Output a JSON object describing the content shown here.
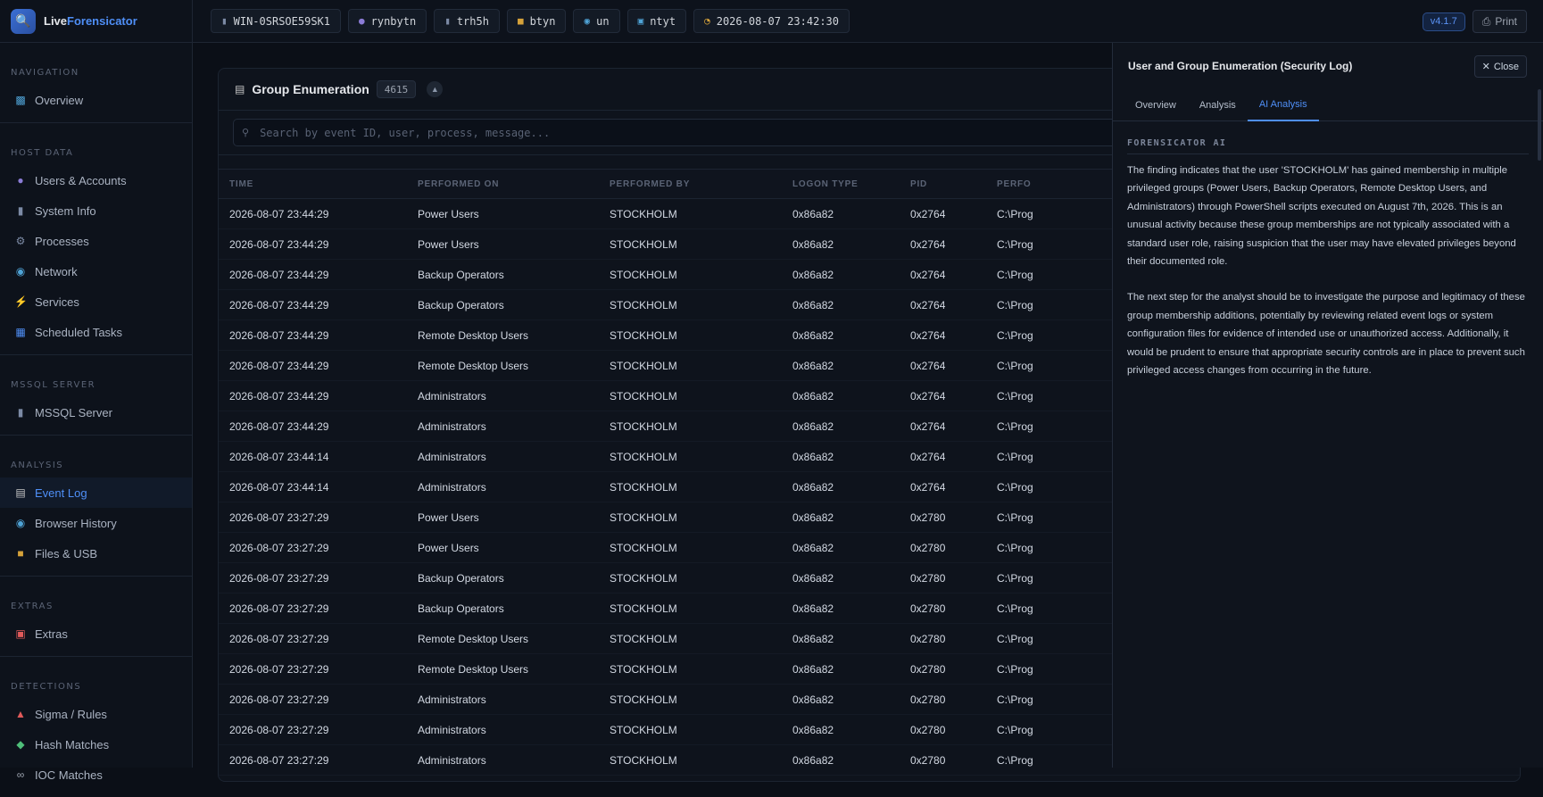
{
  "app": {
    "brand_prefix": "Live",
    "brand_suffix": "Forensicator",
    "version": "v4.1.7",
    "print_label": "Print"
  },
  "topbar": {
    "chips": [
      {
        "icon": "server-icon",
        "text": "WIN-0SRSOE59SK1"
      },
      {
        "icon": "user-icon",
        "text": "rynbytn"
      },
      {
        "icon": "server-icon",
        "text": "trh5h"
      },
      {
        "icon": "folder-icon",
        "text": "btyn"
      },
      {
        "icon": "globe-icon",
        "text": "un"
      },
      {
        "icon": "monitor-icon",
        "text": "ntyt"
      },
      {
        "icon": "clock-icon",
        "text": "2026-08-07 23:42:30"
      }
    ]
  },
  "sidebar": {
    "sections": [
      {
        "heading": "NAVIGATION",
        "items": [
          {
            "label": "Overview",
            "icon": "chart-icon"
          }
        ]
      },
      {
        "heading": "HOST DATA",
        "items": [
          {
            "label": "Users & Accounts",
            "icon": "user-icon"
          },
          {
            "label": "System Info",
            "icon": "server-icon"
          },
          {
            "label": "Processes",
            "icon": "gear-icon"
          },
          {
            "label": "Network",
            "icon": "globe-icon"
          },
          {
            "label": "Services",
            "icon": "bolt-icon"
          },
          {
            "label": "Scheduled Tasks",
            "icon": "calendar-icon"
          }
        ]
      },
      {
        "heading": "MSSQL SERVER",
        "items": [
          {
            "label": "MSSQL Server",
            "icon": "database-icon"
          }
        ]
      },
      {
        "heading": "ANALYSIS",
        "items": [
          {
            "label": "Event Log",
            "icon": "log-icon",
            "active": true
          },
          {
            "label": "Browser History",
            "icon": "earth-icon"
          },
          {
            "label": "Files & USB",
            "icon": "folder-icon"
          }
        ]
      },
      {
        "heading": "EXTRAS",
        "items": [
          {
            "label": "Extras",
            "icon": "toolbox-icon"
          }
        ]
      },
      {
        "heading": "DETECTIONS",
        "items": [
          {
            "label": "Sigma / Rules",
            "icon": "siren-icon"
          },
          {
            "label": "Hash Matches",
            "icon": "hash-icon"
          },
          {
            "label": "IOC Matches",
            "icon": "link-icon"
          }
        ]
      }
    ]
  },
  "card": {
    "title": "Group Enumeration",
    "count": "4615",
    "search_placeholder": "Search by event ID, user, process, message...",
    "columns": [
      "TIME",
      "PERFORMED ON",
      "PERFORMED BY",
      "LOGON TYPE",
      "PID",
      "PERFO"
    ],
    "rows": [
      [
        "2026-08-07 23:44:29",
        "Power Users",
        "STOCKHOLM",
        "0x86a82",
        "0x2764",
        "C:\\Prog"
      ],
      [
        "2026-08-07 23:44:29",
        "Power Users",
        "STOCKHOLM",
        "0x86a82",
        "0x2764",
        "C:\\Prog"
      ],
      [
        "2026-08-07 23:44:29",
        "Backup Operators",
        "STOCKHOLM",
        "0x86a82",
        "0x2764",
        "C:\\Prog"
      ],
      [
        "2026-08-07 23:44:29",
        "Backup Operators",
        "STOCKHOLM",
        "0x86a82",
        "0x2764",
        "C:\\Prog"
      ],
      [
        "2026-08-07 23:44:29",
        "Remote Desktop Users",
        "STOCKHOLM",
        "0x86a82",
        "0x2764",
        "C:\\Prog"
      ],
      [
        "2026-08-07 23:44:29",
        "Remote Desktop Users",
        "STOCKHOLM",
        "0x86a82",
        "0x2764",
        "C:\\Prog"
      ],
      [
        "2026-08-07 23:44:29",
        "Administrators",
        "STOCKHOLM",
        "0x86a82",
        "0x2764",
        "C:\\Prog"
      ],
      [
        "2026-08-07 23:44:29",
        "Administrators",
        "STOCKHOLM",
        "0x86a82",
        "0x2764",
        "C:\\Prog"
      ],
      [
        "2026-08-07 23:44:14",
        "Administrators",
        "STOCKHOLM",
        "0x86a82",
        "0x2764",
        "C:\\Prog"
      ],
      [
        "2026-08-07 23:44:14",
        "Administrators",
        "STOCKHOLM",
        "0x86a82",
        "0x2764",
        "C:\\Prog"
      ],
      [
        "2026-08-07 23:27:29",
        "Power Users",
        "STOCKHOLM",
        "0x86a82",
        "0x2780",
        "C:\\Prog"
      ],
      [
        "2026-08-07 23:27:29",
        "Power Users",
        "STOCKHOLM",
        "0x86a82",
        "0x2780",
        "C:\\Prog"
      ],
      [
        "2026-08-07 23:27:29",
        "Backup Operators",
        "STOCKHOLM",
        "0x86a82",
        "0x2780",
        "C:\\Prog"
      ],
      [
        "2026-08-07 23:27:29",
        "Backup Operators",
        "STOCKHOLM",
        "0x86a82",
        "0x2780",
        "C:\\Prog"
      ],
      [
        "2026-08-07 23:27:29",
        "Remote Desktop Users",
        "STOCKHOLM",
        "0x86a82",
        "0x2780",
        "C:\\Prog"
      ],
      [
        "2026-08-07 23:27:29",
        "Remote Desktop Users",
        "STOCKHOLM",
        "0x86a82",
        "0x2780",
        "C:\\Prog"
      ],
      [
        "2026-08-07 23:27:29",
        "Administrators",
        "STOCKHOLM",
        "0x86a82",
        "0x2780",
        "C:\\Prog"
      ],
      [
        "2026-08-07 23:27:29",
        "Administrators",
        "STOCKHOLM",
        "0x86a82",
        "0x2780",
        "C:\\Prog"
      ],
      [
        "2026-08-07 23:27:29",
        "Administrators",
        "STOCKHOLM",
        "0x86a82",
        "0x2780",
        "C:\\Prog"
      ]
    ]
  },
  "panel": {
    "title": "User and Group Enumeration (Security Log)",
    "close_label": "Close",
    "tabs": [
      "Overview",
      "Analysis",
      "AI Analysis"
    ],
    "active_tab": "AI Analysis",
    "ai_heading": "FORENSICATOR AI",
    "paragraphs": [
      "The finding indicates that the user 'STOCKHOLM' has gained membership in multiple privileged groups (Power Users, Backup Operators, Remote Desktop Users, and Administrators) through PowerShell scripts executed on August 7th, 2026. This is an unusual activity because these group memberships are not typically associated with a standard user role, raising suspicion that the user may have elevated privileges beyond their documented role.",
      "The next step for the analyst should be to investigate the purpose and legitimacy of these group membership additions, potentially by reviewing related event logs or system configuration files for evidence of intended use or unauthorized access. Additionally, it would be prudent to ensure that appropriate security controls are in place to prevent such privileged access changes from occurring in the future."
    ]
  },
  "colors": {
    "accent": "#4f8ff7",
    "background": "#0b0f17",
    "panel": "#0f141d"
  }
}
